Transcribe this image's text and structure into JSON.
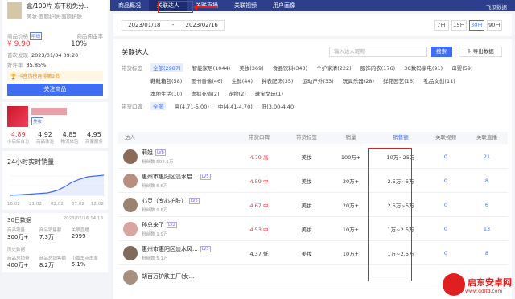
{
  "product": {
    "title": "盒/100片 冻干粉免分...",
    "subtitle": "美妆·面膜护肤·面膜护肤",
    "price_label": "商品价格",
    "price_tag": "明细",
    "price": "¥ 9.90",
    "commission_label": "商品佣金率",
    "commission": "10%",
    "first_seen_label": "首次发现",
    "first_seen": "2023/01/04 09:20",
    "good_rate_label": "好评率",
    "good_rate": "85.85%",
    "warning": "抖音热榜月排第2名",
    "link_button": "关注商品"
  },
  "shop": {
    "tag": "美妆",
    "scores": [
      {
        "value": "4.89",
        "label": "小店综合分",
        "red": true
      },
      {
        "value": "4.92",
        "label": "商品体验",
        "red": false
      },
      {
        "value": "4.85",
        "label": "物流体验",
        "red": false
      },
      {
        "value": "4.95",
        "label": "商家服务",
        "red": false
      }
    ]
  },
  "realtime": {
    "title": "24小时实时销量",
    "x_ticks": [
      "16:02",
      "21:02",
      "02:02",
      "07:02",
      "12:02"
    ]
  },
  "stats30": {
    "title": "30日数据",
    "date": "2023/02/16 14:18",
    "labels": [
      "商品销量",
      "商品销售额",
      "关联直播"
    ],
    "values": [
      "300万+",
      "7.3万",
      "2999"
    ]
  },
  "history": {
    "title": "历史数据",
    "labels": [
      "商品总销量",
      "商品总销售额",
      "小黄车点击率"
    ],
    "values": [
      "400万+",
      "8.2万",
      "5.1%"
    ]
  },
  "nav": {
    "items": [
      "商品概况",
      "关联达人",
      "关联直播",
      "关联视频",
      "用户画像"
    ],
    "active": 1,
    "logo": "飞瓜数据"
  },
  "dates": {
    "start": "2023/01/18",
    "sep": "-",
    "end": "2023/02/16",
    "ranges": [
      "7日",
      "15日",
      "30日",
      "90日"
    ],
    "active_range": 2
  },
  "panel": {
    "title": "关联达人",
    "search_placeholder": "输入达人昵称",
    "search_button": "搜索",
    "export_button": "导出数据",
    "filter_label_1": "带货标签",
    "filters_1": [
      "全部(2987)",
      "智能家居(1044)",
      "美妆(369)",
      "食品饮料(343)",
      "个护家清(222)",
      "服饰内衣(176)",
      "3C数码家电(91)",
      "母婴(59)"
    ],
    "filters_1b": [
      "鞋靴箱包(58)",
      "图书音像(46)",
      "生鲜(44)",
      "钟表配饰(35)",
      "运动户外(33)",
      "玩具乐器(28)",
      "鲜花园艺(16)",
      "礼品文创(11)"
    ],
    "filters_1c": [
      "本地生活(10)",
      "虚拟充值(2)",
      "宠物(2)",
      "珠宝文玩(1)"
    ],
    "filter_label_2": "带货口碑",
    "filters_2": [
      "全部",
      "高(4.71-5.00)",
      "中(4.41-4.70)",
      "低(3.00-4.40)"
    ]
  },
  "table": {
    "headers": [
      "达人",
      "带货口碑",
      "带货标签",
      "销量",
      "销售额",
      "关联视频",
      "关联直播"
    ],
    "rows": [
      {
        "name": "莉姐",
        "lv": "LV6",
        "fans": "粉丝数 502.1万",
        "score": "4.79 高",
        "tag": "美妆",
        "sales": "100万+",
        "revenue": "10万~25万",
        "videos": "0",
        "lives": "21",
        "red": true,
        "color": "#8a6b5a"
      },
      {
        "name": "惠州市惠阳区淡水启...",
        "lv": "LV5",
        "fans": "粉丝数 5.6万",
        "score": "4.59 中",
        "tag": "美妆",
        "sales": "30万+",
        "revenue": "2.5万~5万",
        "videos": "0",
        "lives": "8",
        "red": true,
        "color": "#b88f7e"
      },
      {
        "name": "心灵（专心护肤）",
        "lv": "LV5",
        "fans": "粉丝数 9.8万",
        "score": "4.67 中",
        "tag": "美妆",
        "sales": "20万+",
        "revenue": "2.5万~5万",
        "videos": "0",
        "lives": "6",
        "red": true,
        "color": "#9a8470"
      },
      {
        "name": "孙总来了",
        "lv": "LV2",
        "fans": "粉丝数 1.9万",
        "score": "4.53 中",
        "tag": "美妆",
        "sales": "10万+",
        "revenue": "1万~2.5万",
        "videos": "0",
        "lives": "13",
        "red": true,
        "color": "#d9a5a0"
      },
      {
        "name": "惠州市惠阳区淡水风...",
        "lv": "LV3",
        "fans": "粉丝数 5.1万",
        "score": "4.37 低",
        "tag": "美妆",
        "sales": "10万+",
        "revenue": "1万~2.5万",
        "videos": "0",
        "lives": "8",
        "red": false,
        "color": "#7f6a5c"
      },
      {
        "name": "胡百万护肤工厂(女...",
        "lv": "",
        "fans": "",
        "score": "",
        "tag": "",
        "sales": "",
        "revenue": "",
        "videos": "",
        "lives": "",
        "red": false,
        "color": "#a58f7e"
      }
    ]
  },
  "watermark": {
    "title": "启东安卓网",
    "url": "www.qdltd.com"
  }
}
